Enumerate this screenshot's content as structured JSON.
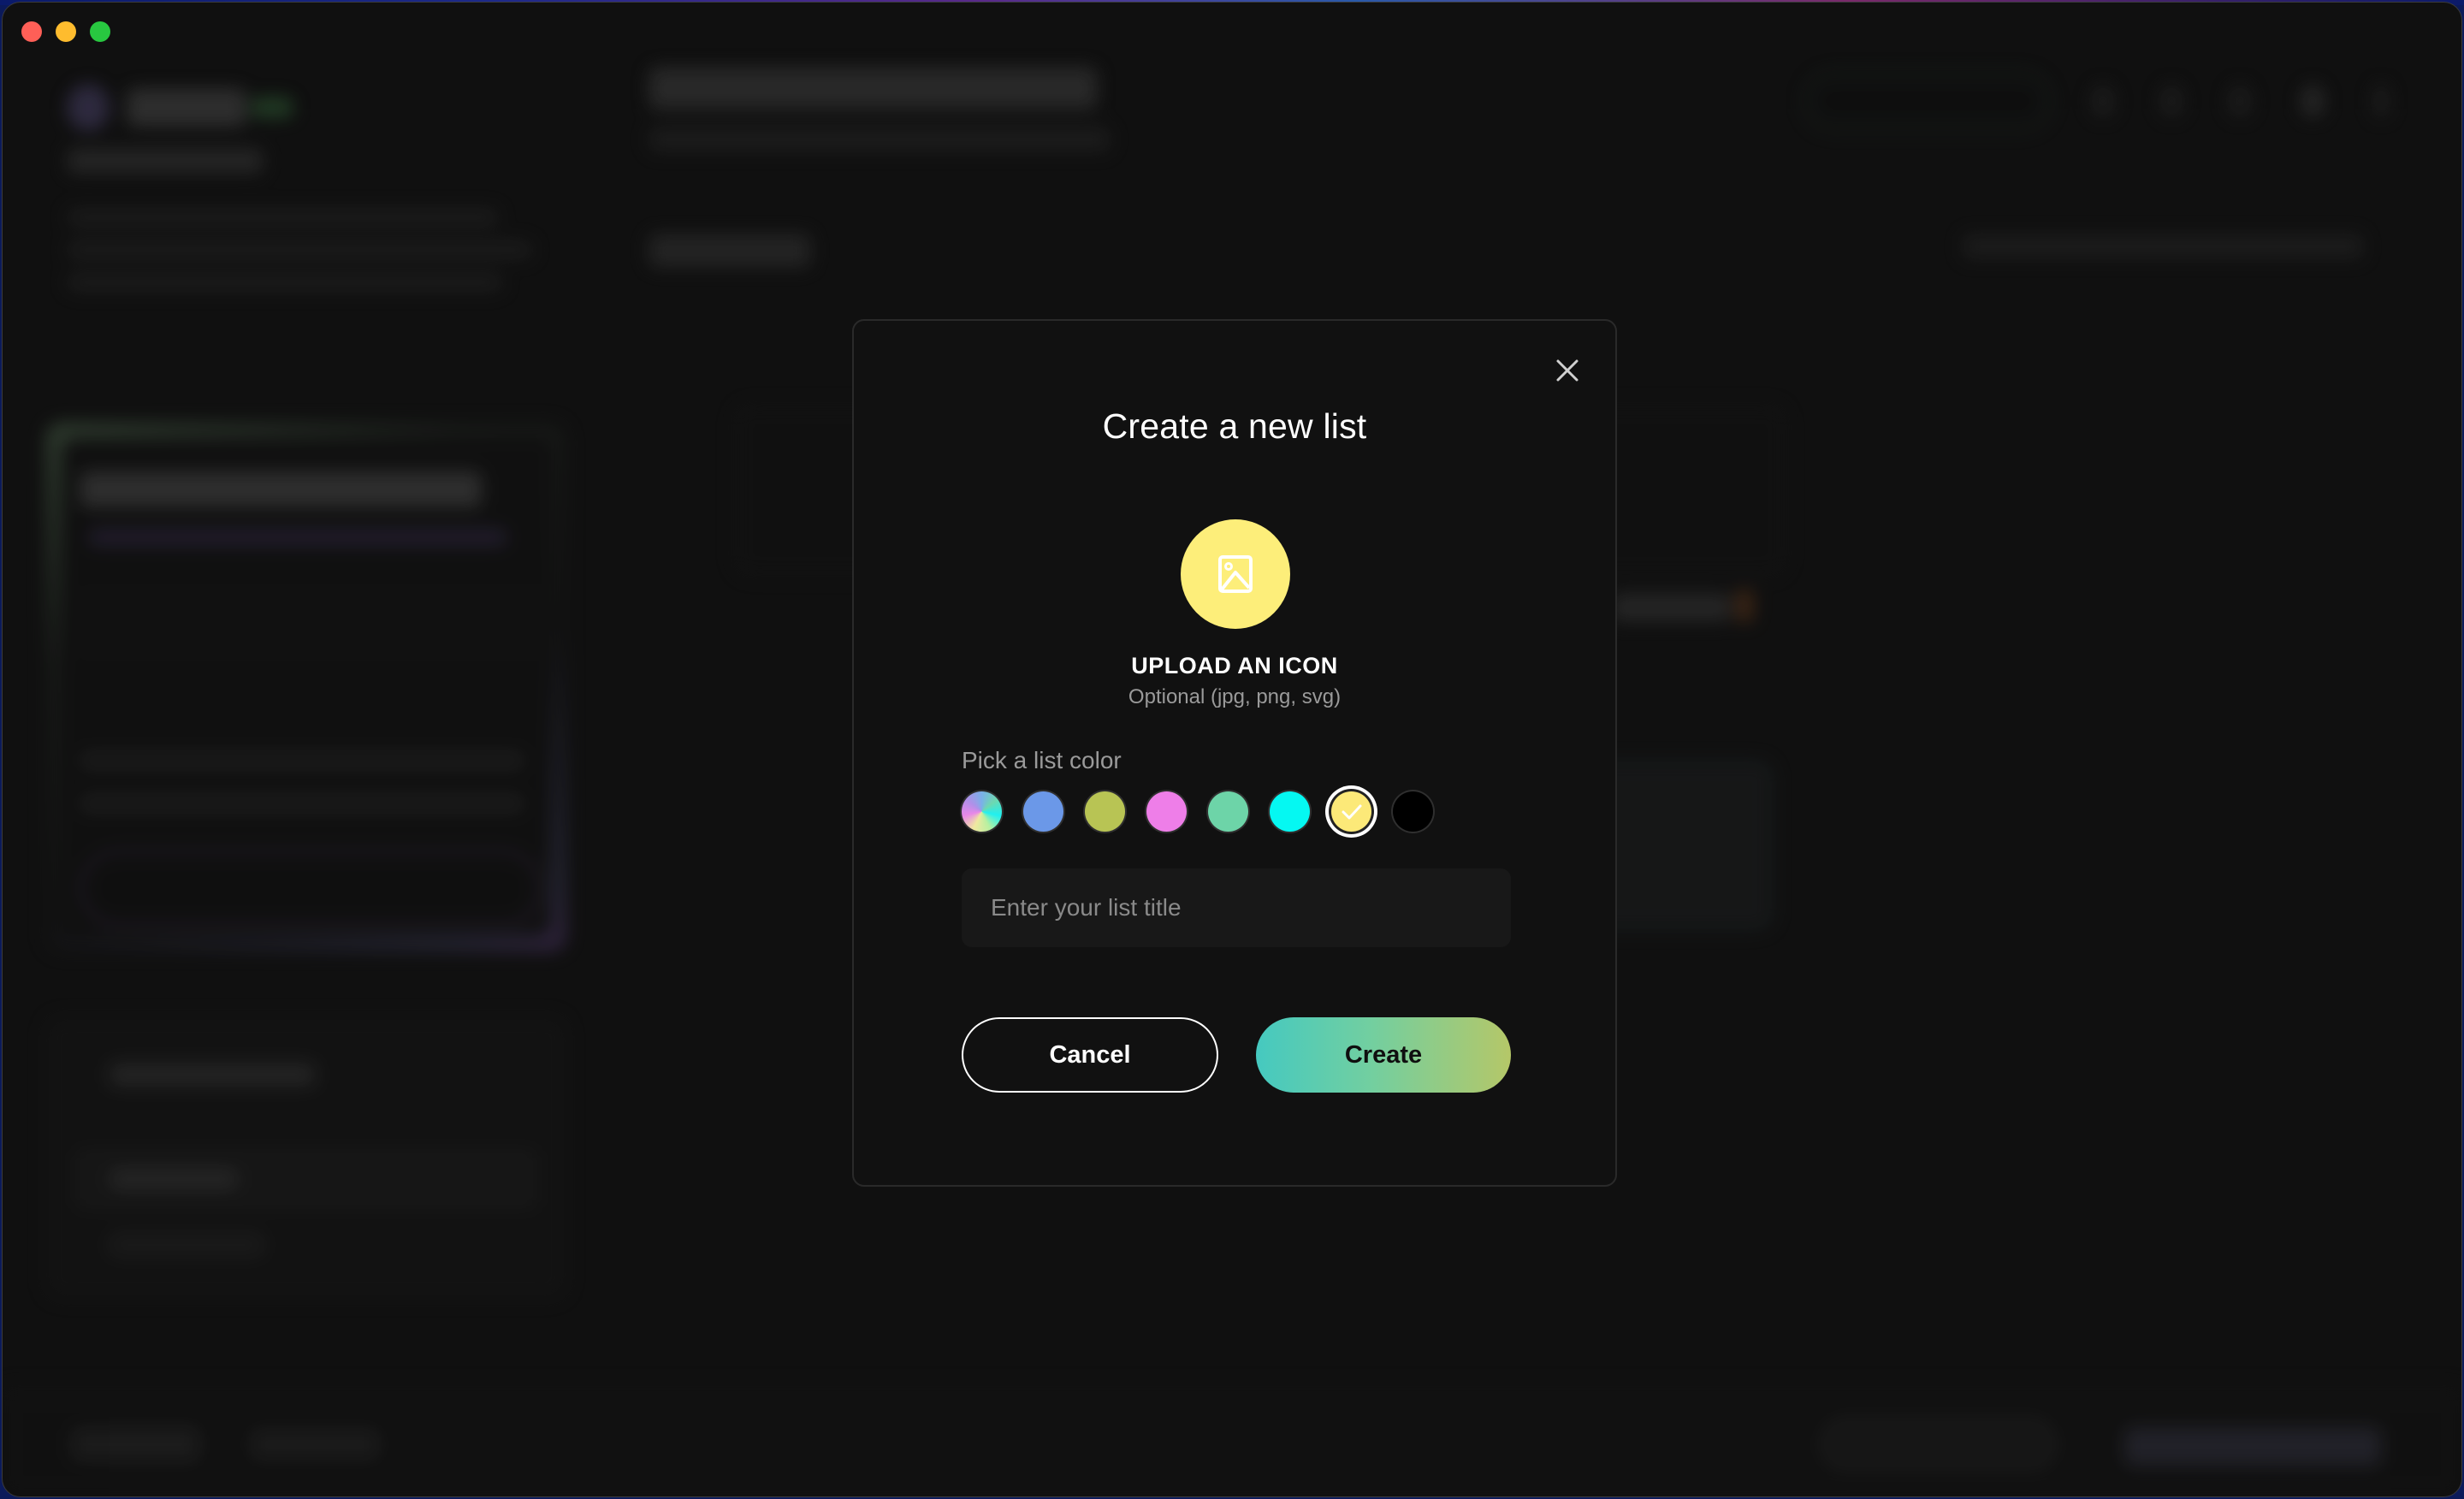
{
  "modal": {
    "title": "Create a new list",
    "upload": {
      "icon": "image-icon",
      "label": "UPLOAD AN ICON",
      "hint": "Optional (jpg, png, svg)",
      "circle_color": "#fdee7a"
    },
    "color_picker": {
      "label": "Pick a list color",
      "selected_index": 6,
      "options": [
        {
          "name": "rainbow",
          "color": "conic-gradient"
        },
        {
          "name": "blue",
          "color": "#6b98e8"
        },
        {
          "name": "olive",
          "color": "#b8c454"
        },
        {
          "name": "pink",
          "color": "#ee7ee8"
        },
        {
          "name": "mint",
          "color": "#6dd4a8"
        },
        {
          "name": "cyan",
          "color": "#05f8f2"
        },
        {
          "name": "yellow",
          "color": "#fce978"
        },
        {
          "name": "black",
          "color": "#000000"
        }
      ]
    },
    "title_input": {
      "value": "",
      "placeholder": "Enter your list title"
    },
    "buttons": {
      "cancel": "Cancel",
      "create": "Create"
    },
    "close_icon": "close-icon"
  },
  "window": {
    "traffic_lights": [
      "close",
      "minimize",
      "maximize"
    ]
  }
}
